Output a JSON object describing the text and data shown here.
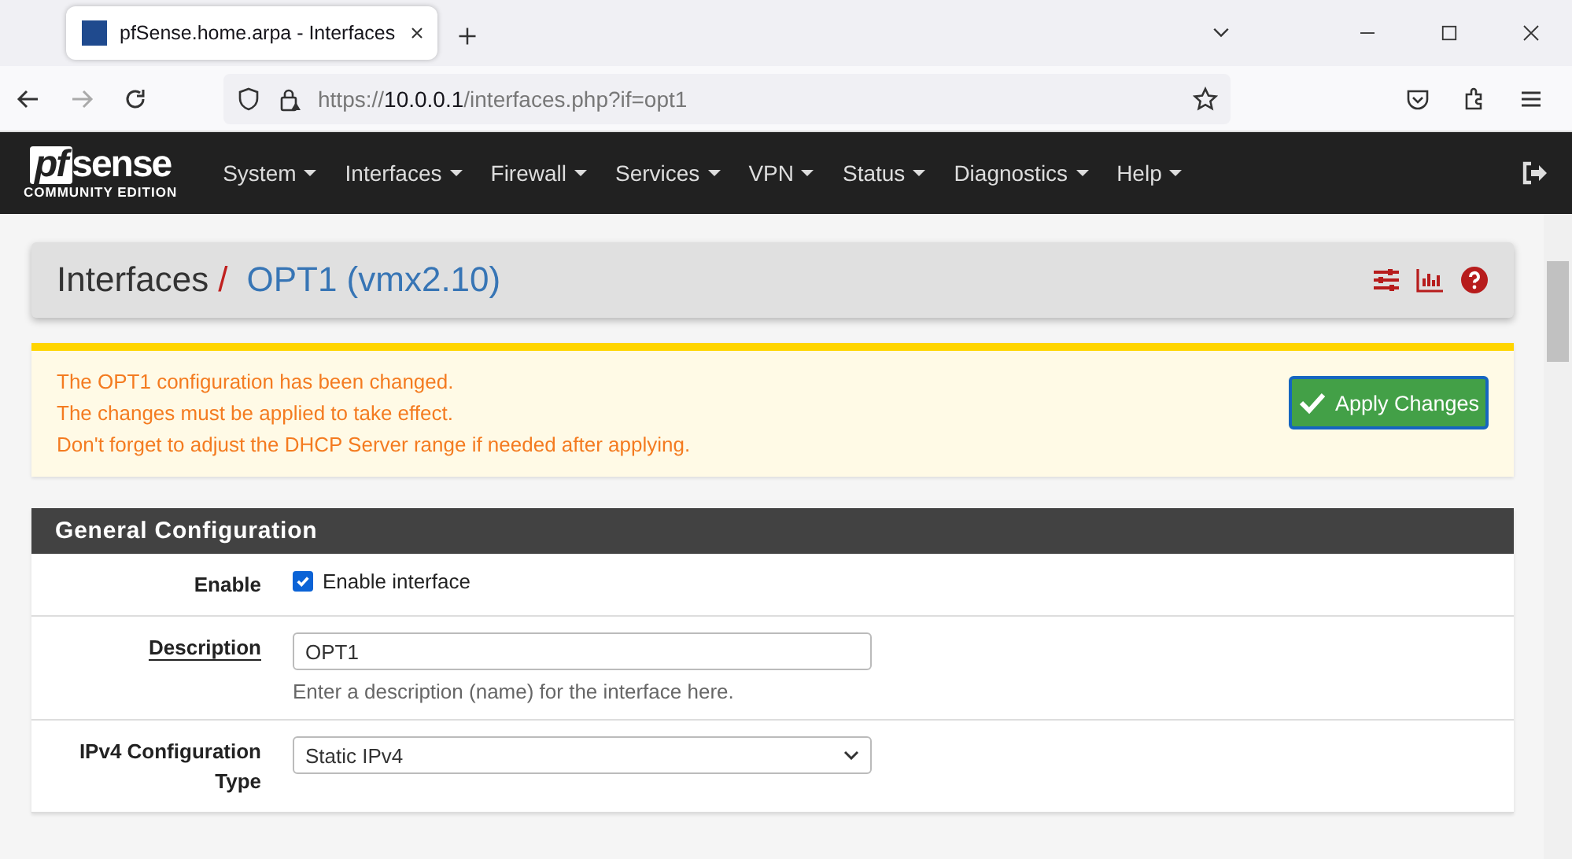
{
  "browser": {
    "tab": {
      "title": "pfSense.home.arpa - Interfaces",
      "selected": true
    },
    "url": {
      "scheme": "https://",
      "host": "10.0.0.1",
      "path": "/interfaces.php?if=opt1"
    }
  },
  "navbar": {
    "logo": {
      "mark": "pf",
      "word": "sense",
      "edition": "COMMUNITY EDITION"
    },
    "menus": [
      "System",
      "Interfaces",
      "Firewall",
      "Services",
      "VPN",
      "Status",
      "Diagnostics",
      "Help"
    ]
  },
  "breadcrumb": {
    "section": "Interfaces",
    "separator": "/",
    "current": "OPT1 (vmx2.10)"
  },
  "alert": {
    "lines": [
      "The OPT1 configuration has been changed.",
      "The changes must be applied to take effect.",
      "Don't forget to adjust the DHCP Server range if needed after applying."
    ],
    "button": "Apply Changes"
  },
  "panel": {
    "title": "General Configuration",
    "rows": [
      {
        "kind": "checkbox",
        "label": "Enable",
        "checked": true,
        "text": "Enable interface"
      },
      {
        "kind": "text",
        "label": "Description",
        "value": "OPT1",
        "help": "Enter a description (name) for the interface here."
      },
      {
        "kind": "select",
        "label": "IPv4 Configuration Type",
        "value": "Static IPv4"
      }
    ]
  }
}
